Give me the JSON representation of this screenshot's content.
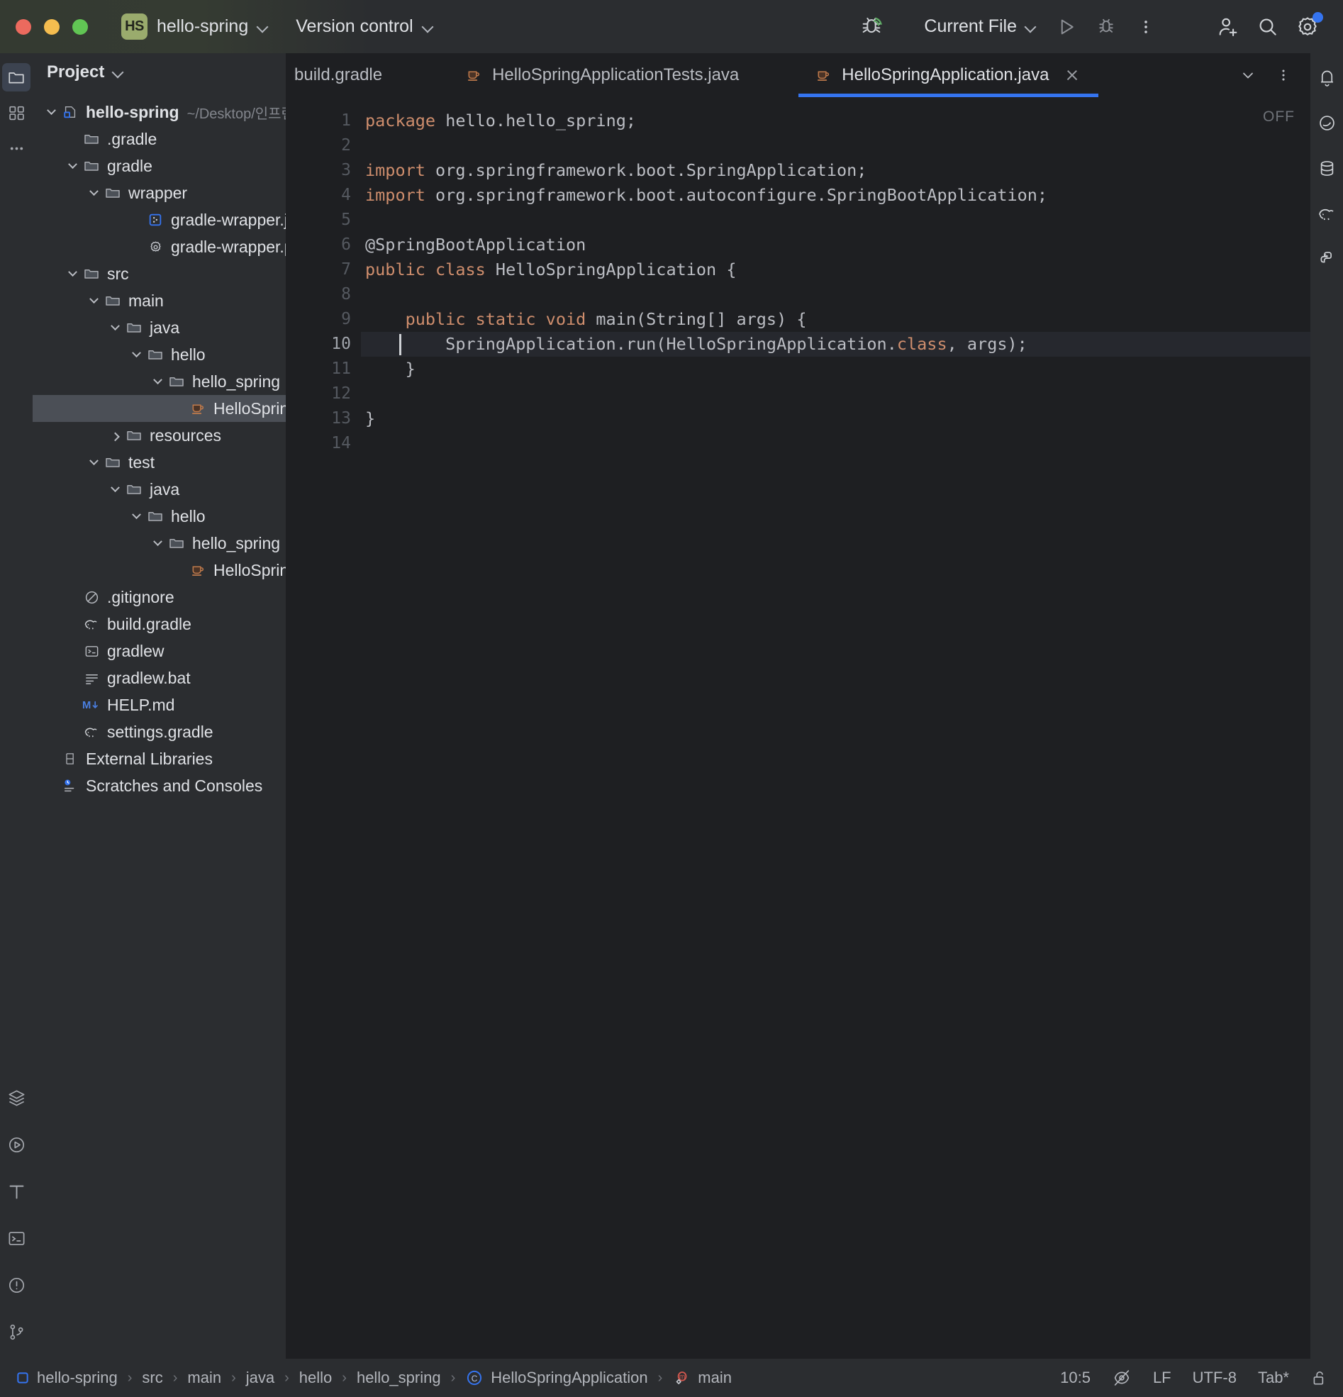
{
  "titlebar": {
    "project_badge": "HS",
    "project_name": "hello-spring",
    "vcs_label": "Version control",
    "run_config": "Current File",
    "icons": {
      "bug_wifi": "debug-with-coverage-icon",
      "run": "run-icon",
      "debug": "debug-icon",
      "more": "more-vertical-icon",
      "add_user": "add-user-icon",
      "search": "search-icon",
      "settings": "settings-gear-icon"
    }
  },
  "project_panel": {
    "title": "Project",
    "tree": [
      {
        "label": "hello-spring",
        "path": "~/Desktop/인프런/김영",
        "depth": 0,
        "arrow": "down",
        "icon": "module-icon",
        "bold": true,
        "selected": false
      },
      {
        "label": ".gradle",
        "path": "",
        "depth": 1,
        "arrow": "none",
        "icon": "folder-icon",
        "bold": false,
        "selected": false
      },
      {
        "label": "gradle",
        "path": "",
        "depth": 1,
        "arrow": "down",
        "icon": "folder-icon",
        "bold": false,
        "selected": false
      },
      {
        "label": "wrapper",
        "path": "",
        "depth": 2,
        "arrow": "down",
        "icon": "folder-icon",
        "bold": false,
        "selected": false
      },
      {
        "label": "gradle-wrapper.jar",
        "path": "",
        "depth": 4,
        "arrow": "none",
        "icon": "jar-icon",
        "bold": false,
        "selected": false
      },
      {
        "label": "gradle-wrapper.propertie",
        "path": "",
        "depth": 4,
        "arrow": "none",
        "icon": "properties-icon",
        "bold": false,
        "selected": false
      },
      {
        "label": "src",
        "path": "",
        "depth": 1,
        "arrow": "down",
        "icon": "folder-icon",
        "bold": false,
        "selected": false
      },
      {
        "label": "main",
        "path": "",
        "depth": 2,
        "arrow": "down",
        "icon": "folder-icon",
        "bold": false,
        "selected": false
      },
      {
        "label": "java",
        "path": "",
        "depth": 3,
        "arrow": "down",
        "icon": "folder-icon",
        "bold": false,
        "selected": false
      },
      {
        "label": "hello",
        "path": "",
        "depth": 4,
        "arrow": "down",
        "icon": "folder-icon",
        "bold": false,
        "selected": false
      },
      {
        "label": "hello_spring",
        "path": "",
        "depth": 5,
        "arrow": "down",
        "icon": "folder-icon",
        "bold": false,
        "selected": false
      },
      {
        "label": "HelloSpringApp",
        "path": "",
        "depth": 6,
        "arrow": "none",
        "icon": "java-class-icon",
        "bold": false,
        "selected": true
      },
      {
        "label": "resources",
        "path": "",
        "depth": 3,
        "arrow": "right",
        "icon": "folder-icon",
        "bold": false,
        "selected": false
      },
      {
        "label": "test",
        "path": "",
        "depth": 2,
        "arrow": "down",
        "icon": "folder-icon",
        "bold": false,
        "selected": false
      },
      {
        "label": "java",
        "path": "",
        "depth": 3,
        "arrow": "down",
        "icon": "folder-icon",
        "bold": false,
        "selected": false
      },
      {
        "label": "hello",
        "path": "",
        "depth": 4,
        "arrow": "down",
        "icon": "folder-icon",
        "bold": false,
        "selected": false
      },
      {
        "label": "hello_spring",
        "path": "",
        "depth": 5,
        "arrow": "down",
        "icon": "folder-icon",
        "bold": false,
        "selected": false
      },
      {
        "label": "HelloSpringApp",
        "path": "",
        "depth": 6,
        "arrow": "none",
        "icon": "java-class-icon",
        "bold": false,
        "selected": false
      },
      {
        "label": ".gitignore",
        "path": "",
        "depth": 1,
        "arrow": "none",
        "icon": "gitignore-icon",
        "bold": false,
        "selected": false
      },
      {
        "label": "build.gradle",
        "path": "",
        "depth": 1,
        "arrow": "none",
        "icon": "gradle-elephant-icon",
        "bold": false,
        "selected": false
      },
      {
        "label": "gradlew",
        "path": "",
        "depth": 1,
        "arrow": "none",
        "icon": "terminal-script-icon",
        "bold": false,
        "selected": false
      },
      {
        "label": "gradlew.bat",
        "path": "",
        "depth": 1,
        "arrow": "none",
        "icon": "text-file-icon",
        "bold": false,
        "selected": false
      },
      {
        "label": "HELP.md",
        "path": "",
        "depth": 1,
        "arrow": "none",
        "icon": "markdown-icon",
        "bold": false,
        "selected": false
      },
      {
        "label": "settings.gradle",
        "path": "",
        "depth": 1,
        "arrow": "none",
        "icon": "gradle-elephant-icon",
        "bold": false,
        "selected": false
      },
      {
        "label": "External Libraries",
        "path": "",
        "depth": 0,
        "arrow": "none",
        "icon": "library-icon",
        "bold": false,
        "selected": false
      },
      {
        "label": "Scratches and Consoles",
        "path": "",
        "depth": 0,
        "arrow": "none",
        "icon": "scratches-icon",
        "bold": false,
        "selected": false
      }
    ]
  },
  "tabs": {
    "items": [
      {
        "label": "build.gradle",
        "icon": "",
        "active": false,
        "closable": false
      },
      {
        "label": "HelloSpringApplicationTests.java",
        "icon": "java-class-icon",
        "active": false,
        "closable": false
      },
      {
        "label": "HelloSpringApplication.java",
        "icon": "java-class-icon",
        "active": true,
        "closable": true
      }
    ],
    "chevron_icon": "chevron-down-icon",
    "more_icon": "more-vertical-icon"
  },
  "editor": {
    "inspection_status": "OFF",
    "current_line": 10,
    "lines": [
      {
        "n": 1,
        "parts": [
          {
            "t": "package",
            "c": "kw"
          },
          {
            "t": " hello.hello_spring;",
            "c": ""
          }
        ]
      },
      {
        "n": 2,
        "parts": [
          {
            "t": "",
            "c": ""
          }
        ]
      },
      {
        "n": 3,
        "parts": [
          {
            "t": "import",
            "c": "kw"
          },
          {
            "t": " org.springframework.boot.SpringApplication;",
            "c": ""
          }
        ]
      },
      {
        "n": 4,
        "parts": [
          {
            "t": "import",
            "c": "kw"
          },
          {
            "t": " org.springframework.boot.autoconfigure.SpringBootApplication;",
            "c": ""
          }
        ]
      },
      {
        "n": 5,
        "parts": [
          {
            "t": "",
            "c": ""
          }
        ]
      },
      {
        "n": 6,
        "parts": [
          {
            "t": "@SpringBootApplication",
            "c": ""
          }
        ]
      },
      {
        "n": 7,
        "parts": [
          {
            "t": "public class",
            "c": "kw"
          },
          {
            "t": " HelloSpringApplication {",
            "c": ""
          }
        ]
      },
      {
        "n": 8,
        "parts": [
          {
            "t": "",
            "c": ""
          }
        ]
      },
      {
        "n": 9,
        "parts": [
          {
            "t": "    ",
            "c": ""
          },
          {
            "t": "public static void",
            "c": "kw"
          },
          {
            "t": " main(String[] args) {",
            "c": ""
          }
        ]
      },
      {
        "n": 10,
        "parts": [
          {
            "t": "        SpringApplication.run(HelloSpringApplication.",
            "c": ""
          },
          {
            "t": "class",
            "c": "kw"
          },
          {
            "t": ", args);",
            "c": ""
          }
        ]
      },
      {
        "n": 11,
        "parts": [
          {
            "t": "    }",
            "c": ""
          }
        ]
      },
      {
        "n": 12,
        "parts": [
          {
            "t": "",
            "c": ""
          }
        ]
      },
      {
        "n": 13,
        "parts": [
          {
            "t": "}",
            "c": ""
          }
        ]
      },
      {
        "n": 14,
        "parts": [
          {
            "t": "",
            "c": ""
          }
        ]
      }
    ]
  },
  "right_rail": {
    "icons": [
      "notifications-bell-icon",
      "ai-assistant-icon",
      "database-icon",
      "gradle-elephant-icon",
      "python-packages-icon"
    ]
  },
  "left_rail": {
    "top_icons": [
      "project-folder-icon",
      "structure-icon",
      "more-dots-icon"
    ],
    "bottom_icons": [
      "services-layers-icon",
      "run-icon",
      "build-hammer-icon",
      "terminal-icon",
      "problems-icon",
      "git-branch-icon"
    ]
  },
  "status_bar": {
    "breadcrumbs": [
      {
        "label": "hello-spring",
        "icon": "module-icon"
      },
      {
        "label": "src",
        "icon": ""
      },
      {
        "label": "main",
        "icon": ""
      },
      {
        "label": "java",
        "icon": ""
      },
      {
        "label": "hello",
        "icon": ""
      },
      {
        "label": "hello_spring",
        "icon": ""
      },
      {
        "label": "HelloSpringApplication",
        "icon": "class-c-icon"
      },
      {
        "label": "main",
        "icon": "method-m-icon"
      }
    ],
    "caret_position": "10:5",
    "line_separator": "LF",
    "encoding": "UTF-8",
    "indent": "Tab*",
    "inspection_icon": "inspections-off-icon",
    "lock_icon": "lock-open-icon"
  },
  "colors": {
    "bg_editor": "#1e1f22",
    "bg_panel": "#2b2d30",
    "accent_blue": "#3574f0",
    "keyword_orange": "#cf8e6d",
    "text_primary": "#dfe1e5",
    "text_muted": "#83868d",
    "selection": "#4b4f56",
    "java_icon": "#c07a4b",
    "badge_green": "#9aab6d"
  }
}
